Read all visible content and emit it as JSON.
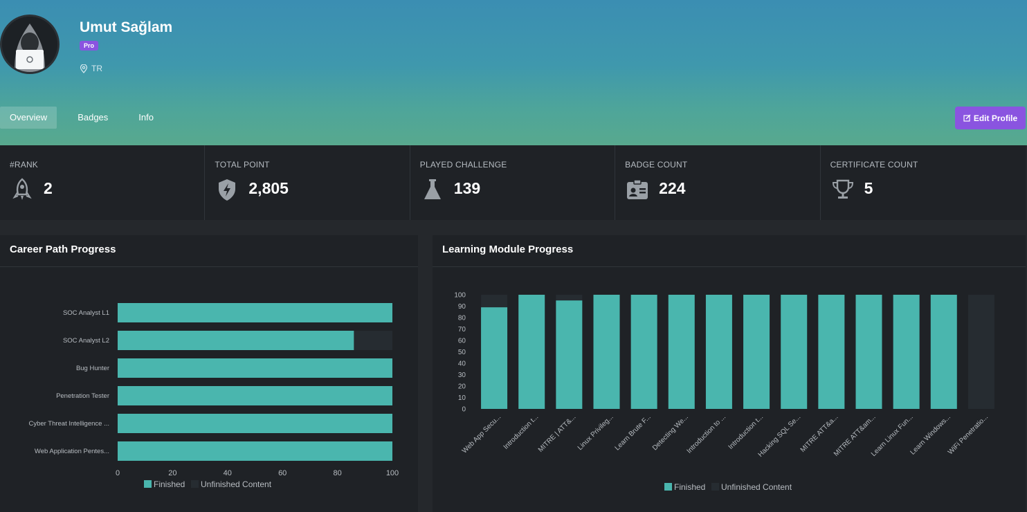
{
  "profile": {
    "name": "Umut Sağlam",
    "badge": "Pro",
    "location": "TR"
  },
  "tabs": [
    {
      "label": "Overview",
      "active": true
    },
    {
      "label": "Badges",
      "active": false
    },
    {
      "label": "Info",
      "active": false
    }
  ],
  "edit_button": {
    "label": "Edit Profile",
    "icon": "edit-icon"
  },
  "stats": [
    {
      "label": "#RANK",
      "value": "2",
      "icon": "rocket-icon"
    },
    {
      "label": "TOTAL POINT",
      "value": "2,805",
      "icon": "shield-bolt-icon"
    },
    {
      "label": "PLAYED CHALLENGE",
      "value": "139",
      "icon": "flask-icon"
    },
    {
      "label": "BADGE COUNT",
      "value": "224",
      "icon": "id-badge-icon"
    },
    {
      "label": "CERTIFICATE COUNT",
      "value": "5",
      "icon": "trophy-icon"
    }
  ],
  "panels": {
    "career_title": "Career Path Progress",
    "learning_title": "Learning Module Progress"
  },
  "colors": {
    "accent": "#8a54e0",
    "finished": "#4ab6ae",
    "unfinished": "#262c31",
    "panel": "#1f2226"
  },
  "chart_data": [
    {
      "type": "bar",
      "orientation": "horizontal",
      "stacked": true,
      "categories": [
        "SOC Analyst L1",
        "SOC Analyst L2",
        "Bug Hunter",
        "Penetration Tester",
        "Cyber Threat Intelligence ...",
        "Web Application Pentes..."
      ],
      "series": [
        {
          "name": "Finished",
          "values": [
            100,
            86,
            100,
            100,
            100,
            100
          ]
        },
        {
          "name": "Unfinished Content",
          "values": [
            0,
            14,
            0,
            0,
            0,
            0
          ]
        }
      ],
      "xlim": [
        0,
        100
      ],
      "xticks": [
        0,
        20,
        40,
        60,
        80,
        100
      ],
      "legend": "bottom"
    },
    {
      "type": "bar",
      "stacked": true,
      "categories": [
        "Web App Secu...",
        "Introduction t...",
        "MITRE | ATT&...",
        "Linux Privileg...",
        "Learn Brute F...",
        "Detecting We...",
        "Introduction to ...",
        "Introduction t...",
        "Hacking SQL Se...",
        "MITRE ATT&a...",
        "MITRE ATT&am...",
        "Learn Linux Fun...",
        "Learn Windows...",
        "WiFi Penetratio..."
      ],
      "series": [
        {
          "name": "Finished",
          "values": [
            89,
            100,
            95,
            100,
            100,
            100,
            100,
            100,
            100,
            100,
            100,
            100,
            100,
            0
          ]
        },
        {
          "name": "Unfinished Content",
          "values": [
            11,
            0,
            5,
            0,
            0,
            0,
            0,
            0,
            0,
            0,
            0,
            0,
            0,
            100
          ]
        }
      ],
      "ylim": [
        0,
        100
      ],
      "yticks": [
        0,
        10,
        20,
        30,
        40,
        50,
        60,
        70,
        80,
        90,
        100
      ],
      "legend": "bottom"
    }
  ]
}
